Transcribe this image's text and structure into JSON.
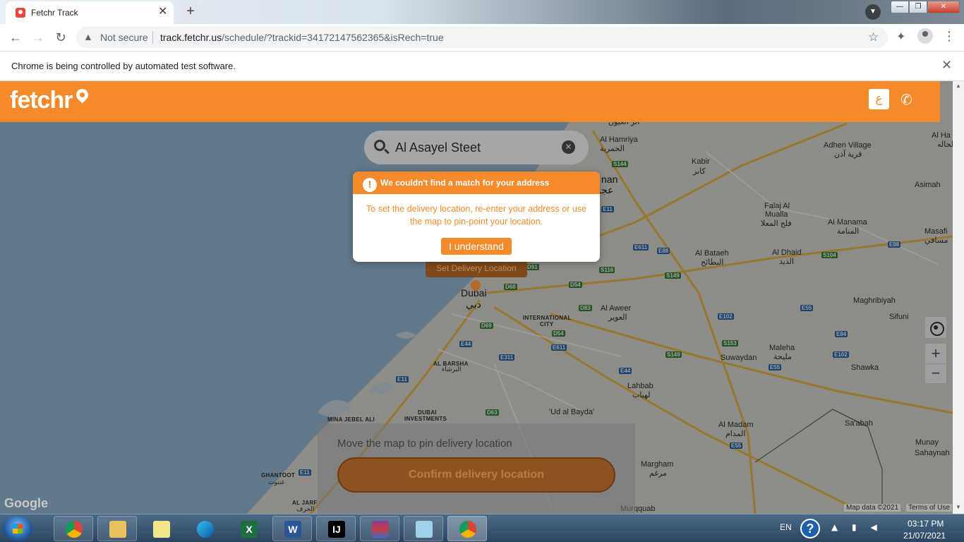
{
  "browser": {
    "tab_title": "Fetchr Track",
    "tab_close": "✕",
    "new_tab": "+",
    "security_label": "Not secure",
    "url_host": "track.fetchr.us",
    "url_path": "/schedule/?trackid=34172147562365&isRech=true",
    "automation_notice": "Chrome is being controlled by automated test software.",
    "infobar_close": "✕"
  },
  "header": {
    "logo_text": "fetchr",
    "language_button": "ع",
    "phone_icon": "✆"
  },
  "search": {
    "value": "Al Asayel Steet",
    "clear_icon": "✕"
  },
  "modal": {
    "alert_icon": "!",
    "title": "We couldn't find a match for your address",
    "body": "To set the delivery location, re-enter your address or use the map to pin-point your location.",
    "button": "I understand"
  },
  "map": {
    "set_delivery_label": "Set Delivery Location",
    "labels": {
      "dubai_en": "Dubai",
      "dubai_ar": "دبي",
      "al_hamriya_en": "Al Hamriya",
      "al_hamriya_ar": "الحمرية",
      "al_fayouh_ar": "الر العيون",
      "kabir_en": "Kabir",
      "kabir_ar": "كابر",
      "adhen_en": "Adhen Village",
      "adhen_ar": "قرية آذن",
      "asimah": "Asimah",
      "falaj_en": "Falaj Al",
      "falaj_en2": "Mualla",
      "falaj_ar": "فلج المعلا",
      "al_manama_en": "Al Manama",
      "al_manama_ar": "المنامة",
      "masafi_en": "Masafi",
      "masafi_ar": "مسافي",
      "al_bataeh_en": "Al Bataeh",
      "al_bataeh_ar": "البطائح",
      "al_dhaid_en": "Al Dhaid",
      "al_dhaid_ar": "الذيد",
      "ajman_part": "nan",
      "ajman_part_ar": "عجـ",
      "al_aweer_en": "Al Aweer",
      "al_aweer_ar": "العوير",
      "maghribiyah": "Maghribiyah",
      "sifuni": "Sifuni",
      "international_city": "INTERNATIONAL",
      "international_city2": "CITY",
      "al_barsha": "AL BARSHA",
      "al_barsha_ar": "البرشاء",
      "maleha_en": "Maleha",
      "maleha_ar": "مليحة",
      "suwaydan": "Suwaydan",
      "shawka": "Shawka",
      "lahbab_en": "Lahbab",
      "lahbab_ar": "لهباب",
      "dubai_investments": "DUBAI",
      "dubai_investments2": "INVESTMENTS",
      "mina_jebel_ali": "MINA JEBEL ALI",
      "ud_al_bayda": "'Ud al Bayda'",
      "al_madam_en": "Al Madam",
      "al_madam_ar": "المدام",
      "saabah": "Sa'abah",
      "munay": "Munay",
      "sahaynah": "Sahaynah",
      "margham_en": "Margham",
      "margham_ar": "مرغم",
      "ghantoot_en": "GHANTOOT",
      "ghantoot_ar": "غنتوت",
      "al_jarf_en": "AL JARF",
      "al_jarf_ar": "الجرف",
      "murqquab": "Murqquab",
      "al_ha": "Al Ha",
      "al_ha_ar": "الحاله"
    },
    "roads": [
      "S144",
      "E11",
      "E611",
      "E88",
      "S116",
      "S149",
      "S104",
      "E88b",
      "E55",
      "D54",
      "D68",
      "D83",
      "D69",
      "D54b",
      "E44",
      "E311",
      "E611b",
      "E102",
      "E84",
      "S153",
      "E55b",
      "E102b",
      "S149b",
      "E44b",
      "E11b",
      "D63",
      "E55c",
      "E11c",
      "D91"
    ],
    "road_labels": {
      "S144": "S144",
      "E11": "E11",
      "E611": "E611",
      "E88": "E88",
      "S116": "S116",
      "S149": "S149",
      "S104": "S104",
      "E88b": "E88",
      "E55": "E55",
      "D54": "D54",
      "D68": "D68",
      "D83": "D83",
      "D69": "D69",
      "D54b": "D54",
      "E44": "E44",
      "E311": "E311",
      "E611b": "E611",
      "E102": "E102",
      "E84": "E84",
      "S153": "S153",
      "E55b": "E55",
      "E102b": "E102",
      "S149b": "S149",
      "E44b": "E44",
      "E11b": "E11",
      "D63": "D63",
      "E55c": "E55",
      "E11c": "E11",
      "D91": "D91"
    },
    "google_logo": "Google",
    "attribution": "Map data ©2021",
    "terms": "Terms of Use",
    "zoom_in": "+",
    "zoom_out": "−"
  },
  "bottom_panel": {
    "hint": "Move the map to pin delivery location",
    "confirm_button": "Confirm delivery location"
  },
  "taskbar": {
    "language": "EN",
    "help": "?",
    "tray_icons": "▲ ▮ ◀",
    "time": "03:17 PM",
    "date": "21/07/2021",
    "apps": [
      "chrome",
      "file-explorer",
      "sticky-notes",
      "edge",
      "excel-like",
      "word",
      "intellij",
      "winrar",
      "notepad",
      "chrome-active"
    ]
  },
  "colors": {
    "brand_orange": "#f58a2b",
    "dim_overlay": "rgba(0,0,0,0.38)",
    "taskbar": "#2b4560"
  }
}
